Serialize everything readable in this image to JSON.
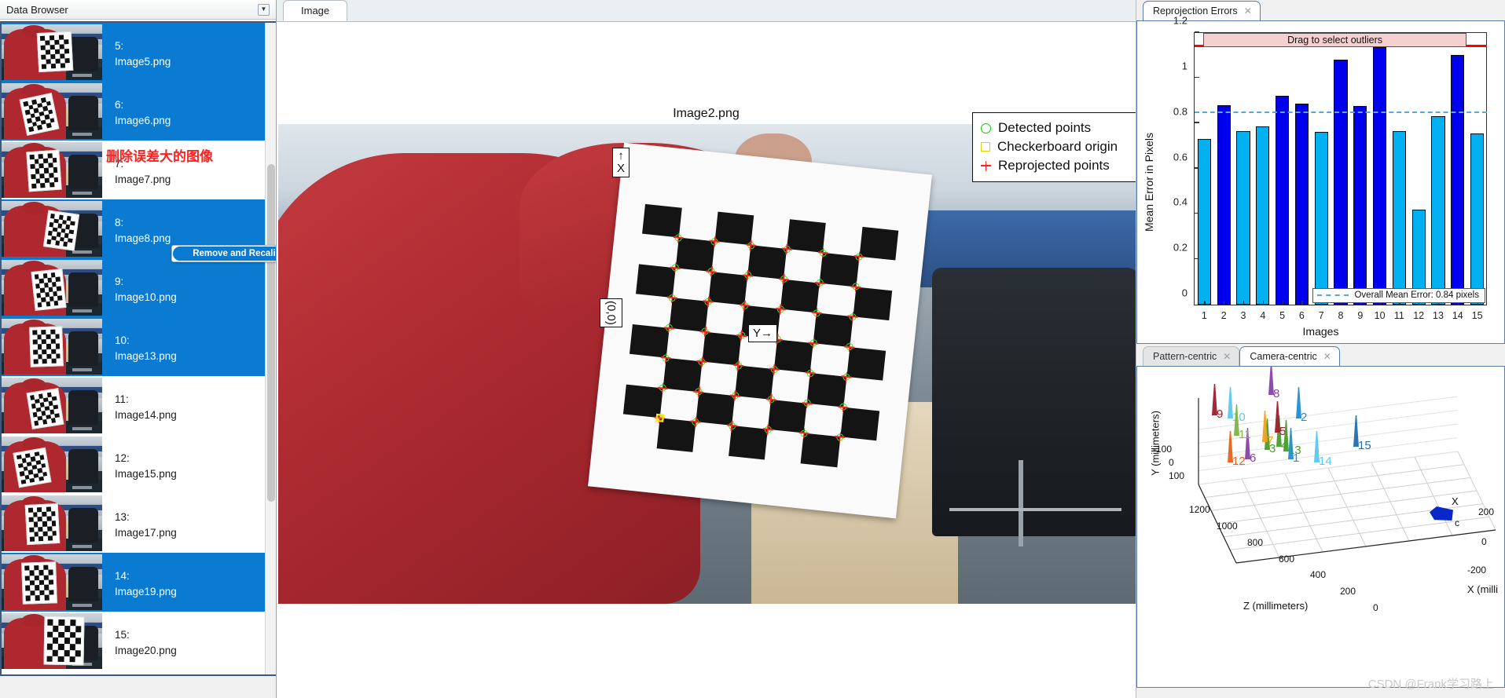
{
  "data_browser": {
    "title": "Data Browser",
    "dropdown_icon": "chevron-down-icon",
    "annotation_note": "删除误差大的图像",
    "remove_button": "Remove and Recalibrate",
    "items": [
      {
        "index": "5:",
        "file": "Image5.png",
        "selected": true
      },
      {
        "index": "6:",
        "file": "Image6.png",
        "selected": true
      },
      {
        "index": "7:",
        "file": "Image7.png",
        "selected": false
      },
      {
        "index": "8:",
        "file": "Image8.png",
        "selected": true
      },
      {
        "index": "9:",
        "file": "Image10.png",
        "selected": true
      },
      {
        "index": "10:",
        "file": "Image13.png",
        "selected": true
      },
      {
        "index": "11:",
        "file": "Image14.png",
        "selected": false
      },
      {
        "index": "12:",
        "file": "Image15.png",
        "selected": false
      },
      {
        "index": "13:",
        "file": "Image17.png",
        "selected": false
      },
      {
        "index": "14:",
        "file": "Image19.png",
        "selected": true
      },
      {
        "index": "15:",
        "file": "Image20.png",
        "selected": false
      }
    ]
  },
  "image_panel": {
    "tab": "Image",
    "image_title": "Image2.png",
    "axis_x_label": "X",
    "axis_y_label": "Y",
    "origin_label": "(0,0)",
    "legend": [
      {
        "symbol": "circle-green-icon",
        "label": "Detected points"
      },
      {
        "symbol": "square-yellow-icon",
        "label": "Checkerboard origin"
      },
      {
        "symbol": "plus-red-icon",
        "label": "Reprojected points"
      }
    ]
  },
  "errors_panel": {
    "tab": "Reprojection Errors",
    "close_icon": "close-icon"
  },
  "extrinsics_panel": {
    "tabs": [
      {
        "label": "Pattern-centric",
        "active": false,
        "close_icon": "close-icon"
      },
      {
        "label": "Camera-centric",
        "active": true,
        "close_icon": "close-icon"
      }
    ]
  },
  "chart_data": {
    "type": "bar",
    "title": "",
    "xlabel": "Images",
    "ylabel": "Mean Error in Pixels",
    "categories": [
      "1",
      "2",
      "3",
      "4",
      "5",
      "6",
      "7",
      "8",
      "9",
      "10",
      "11",
      "12",
      "13",
      "14",
      "15"
    ],
    "values": [
      0.73,
      0.88,
      0.765,
      0.785,
      0.92,
      0.885,
      0.76,
      1.08,
      0.875,
      1.135,
      0.765,
      0.42,
      0.83,
      1.1,
      0.755
    ],
    "bar_colors": [
      "#00b0f0",
      "#0000ee",
      "#00b0f0",
      "#00b0f0",
      "#0000ee",
      "#0000ee",
      "#00b0f0",
      "#0000ee",
      "#0000ee",
      "#0000ee",
      "#00b0f0",
      "#00b0f0",
      "#00b0f0",
      "#0000ee",
      "#00b0f0"
    ],
    "ylim": [
      0,
      1.2
    ],
    "yticks": [
      0,
      0.2,
      0.4,
      0.6,
      0.8,
      1,
      1.2
    ],
    "ytick_labels": [
      "0",
      "0.2",
      "0.4",
      "0.6",
      "0.8",
      "1",
      "1.2"
    ],
    "mean_line_value": 0.845,
    "mean_line_color": "#5aa8d8",
    "threshold_line_value": 1.135,
    "threshold_line_color": "#ff0000",
    "legend_entry": "Overall Mean Error: 0.84 pixels",
    "drag_band_label": "Drag to select outliers",
    "drag_band_color": "#f6cfd0",
    "grid": false,
    "legend_position": "bottom-right"
  },
  "extrinsics_plot": {
    "type": "scatter3d",
    "xlabel": "X (milli",
    "ylabel": "Y (millimeters)",
    "zlabel": "Z (millimeters)",
    "x_ticks": [
      "200",
      "0",
      "-200"
    ],
    "y_ticks": [
      "-100",
      "0",
      "100"
    ],
    "z_ticks": [
      "1200",
      "1000",
      "800",
      "600",
      "400",
      "200",
      "0"
    ],
    "camera_label": "c",
    "camera_axis_x": "X",
    "pattern_labels": [
      {
        "id": "1",
        "color": "#1f8fd0"
      },
      {
        "id": "2",
        "color": "#1f8fd0"
      },
      {
        "id": "3",
        "color": "#4a9c2d"
      },
      {
        "id": "4",
        "color": "#4a9c2d"
      },
      {
        "id": "5",
        "color": "#9b1d2e"
      },
      {
        "id": "6",
        "color": "#8a3fa8"
      },
      {
        "id": "7",
        "color": "#f0a020"
      },
      {
        "id": "8",
        "color": "#8a3fa8"
      },
      {
        "id": "9",
        "color": "#9b1d2e"
      },
      {
        "id": "10",
        "color": "#5ac8f0"
      },
      {
        "id": "11",
        "color": "#7ab648"
      },
      {
        "id": "12",
        "color": "#e8611a"
      },
      {
        "id": "13",
        "color": "#4a9c2d"
      },
      {
        "id": "14",
        "color": "#5ac8f0"
      },
      {
        "id": "15",
        "color": "#1f6fb0"
      }
    ]
  },
  "watermark": "CSDN @Frank学习路上"
}
